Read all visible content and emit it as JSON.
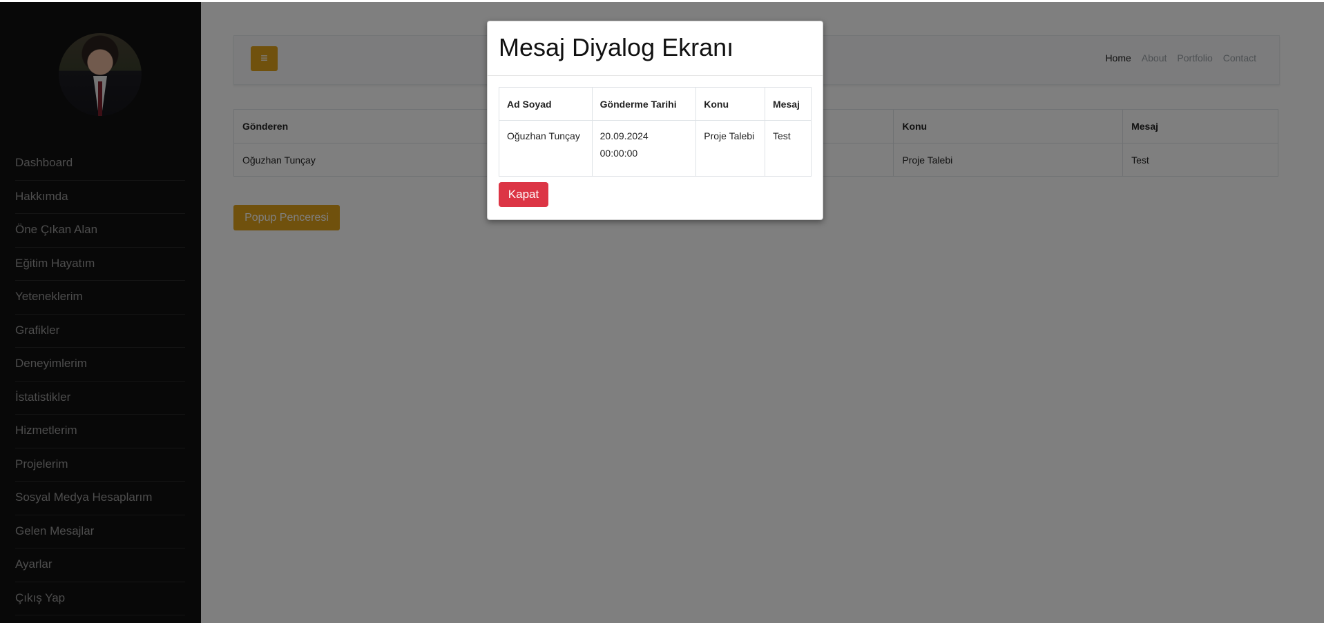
{
  "sidebar": {
    "items": [
      {
        "label": "Dashboard"
      },
      {
        "label": "Hakkımda"
      },
      {
        "label": "Öne Çıkan Alan"
      },
      {
        "label": "Eğitim Hayatım"
      },
      {
        "label": "Yeteneklerim"
      },
      {
        "label": "Grafikler"
      },
      {
        "label": "Deneyimlerim"
      },
      {
        "label": "İstatistikler"
      },
      {
        "label": "Hizmetlerim"
      },
      {
        "label": "Projelerim"
      },
      {
        "label": "Sosyal Medya Hesaplarım"
      },
      {
        "label": "Gelen Mesajlar"
      },
      {
        "label": "Ayarlar"
      },
      {
        "label": "Çıkış Yap"
      }
    ]
  },
  "navbar": {
    "toggle_icon": "≡",
    "links": [
      {
        "label": "Home",
        "active": true
      },
      {
        "label": "About"
      },
      {
        "label": "Portfolio"
      },
      {
        "label": "Contact"
      }
    ]
  },
  "messages_table": {
    "headers": [
      "Gönderen",
      "Konu",
      "Mesaj"
    ],
    "rows": [
      {
        "sender": "Oğuzhan Tunçay",
        "subject": "Proje Talebi",
        "message": "Test"
      }
    ]
  },
  "popup_button": {
    "label": "Popup Penceresi"
  },
  "modal": {
    "title": "Mesaj Diyalog Ekranı",
    "headers": [
      "Ad Soyad",
      "Gönderme Tarihi",
      "Konu",
      "Mesaj"
    ],
    "row": {
      "name": "Oğuzhan Tunçay",
      "date": "20.09.2024 00:00:00",
      "subject": "Proje Talebi",
      "message": "Test"
    },
    "close_label": "Kapat"
  },
  "colors": {
    "sidebar_bg": "#111010",
    "accent": "#e0a21b",
    "danger": "#dc3545"
  }
}
